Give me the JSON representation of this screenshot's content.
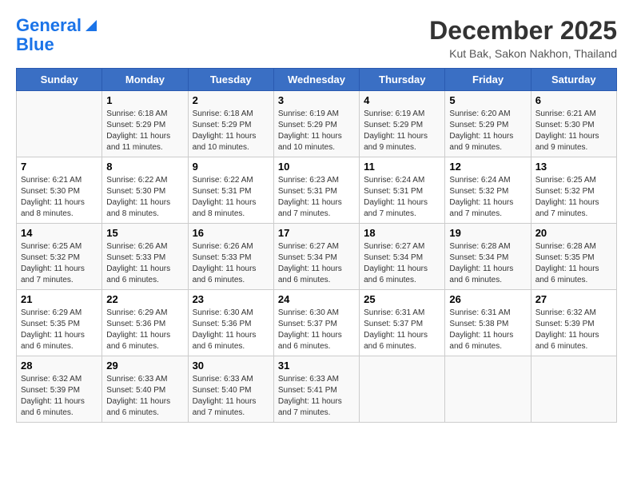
{
  "logo": {
    "line1": "General",
    "line2": "Blue"
  },
  "title": "December 2025",
  "subtitle": "Kut Bak, Sakon Nakhon, Thailand",
  "days_of_week": [
    "Sunday",
    "Monday",
    "Tuesday",
    "Wednesday",
    "Thursday",
    "Friday",
    "Saturday"
  ],
  "weeks": [
    [
      {
        "day": "",
        "info": ""
      },
      {
        "day": "1",
        "info": "Sunrise: 6:18 AM\nSunset: 5:29 PM\nDaylight: 11 hours\nand 11 minutes."
      },
      {
        "day": "2",
        "info": "Sunrise: 6:18 AM\nSunset: 5:29 PM\nDaylight: 11 hours\nand 10 minutes."
      },
      {
        "day": "3",
        "info": "Sunrise: 6:19 AM\nSunset: 5:29 PM\nDaylight: 11 hours\nand 10 minutes."
      },
      {
        "day": "4",
        "info": "Sunrise: 6:19 AM\nSunset: 5:29 PM\nDaylight: 11 hours\nand 9 minutes."
      },
      {
        "day": "5",
        "info": "Sunrise: 6:20 AM\nSunset: 5:29 PM\nDaylight: 11 hours\nand 9 minutes."
      },
      {
        "day": "6",
        "info": "Sunrise: 6:21 AM\nSunset: 5:30 PM\nDaylight: 11 hours\nand 9 minutes."
      }
    ],
    [
      {
        "day": "7",
        "info": "Sunrise: 6:21 AM\nSunset: 5:30 PM\nDaylight: 11 hours\nand 8 minutes."
      },
      {
        "day": "8",
        "info": "Sunrise: 6:22 AM\nSunset: 5:30 PM\nDaylight: 11 hours\nand 8 minutes."
      },
      {
        "day": "9",
        "info": "Sunrise: 6:22 AM\nSunset: 5:31 PM\nDaylight: 11 hours\nand 8 minutes."
      },
      {
        "day": "10",
        "info": "Sunrise: 6:23 AM\nSunset: 5:31 PM\nDaylight: 11 hours\nand 7 minutes."
      },
      {
        "day": "11",
        "info": "Sunrise: 6:24 AM\nSunset: 5:31 PM\nDaylight: 11 hours\nand 7 minutes."
      },
      {
        "day": "12",
        "info": "Sunrise: 6:24 AM\nSunset: 5:32 PM\nDaylight: 11 hours\nand 7 minutes."
      },
      {
        "day": "13",
        "info": "Sunrise: 6:25 AM\nSunset: 5:32 PM\nDaylight: 11 hours\nand 7 minutes."
      }
    ],
    [
      {
        "day": "14",
        "info": "Sunrise: 6:25 AM\nSunset: 5:32 PM\nDaylight: 11 hours\nand 7 minutes."
      },
      {
        "day": "15",
        "info": "Sunrise: 6:26 AM\nSunset: 5:33 PM\nDaylight: 11 hours\nand 6 minutes."
      },
      {
        "day": "16",
        "info": "Sunrise: 6:26 AM\nSunset: 5:33 PM\nDaylight: 11 hours\nand 6 minutes."
      },
      {
        "day": "17",
        "info": "Sunrise: 6:27 AM\nSunset: 5:34 PM\nDaylight: 11 hours\nand 6 minutes."
      },
      {
        "day": "18",
        "info": "Sunrise: 6:27 AM\nSunset: 5:34 PM\nDaylight: 11 hours\nand 6 minutes."
      },
      {
        "day": "19",
        "info": "Sunrise: 6:28 AM\nSunset: 5:34 PM\nDaylight: 11 hours\nand 6 minutes."
      },
      {
        "day": "20",
        "info": "Sunrise: 6:28 AM\nSunset: 5:35 PM\nDaylight: 11 hours\nand 6 minutes."
      }
    ],
    [
      {
        "day": "21",
        "info": "Sunrise: 6:29 AM\nSunset: 5:35 PM\nDaylight: 11 hours\nand 6 minutes."
      },
      {
        "day": "22",
        "info": "Sunrise: 6:29 AM\nSunset: 5:36 PM\nDaylight: 11 hours\nand 6 minutes."
      },
      {
        "day": "23",
        "info": "Sunrise: 6:30 AM\nSunset: 5:36 PM\nDaylight: 11 hours\nand 6 minutes."
      },
      {
        "day": "24",
        "info": "Sunrise: 6:30 AM\nSunset: 5:37 PM\nDaylight: 11 hours\nand 6 minutes."
      },
      {
        "day": "25",
        "info": "Sunrise: 6:31 AM\nSunset: 5:37 PM\nDaylight: 11 hours\nand 6 minutes."
      },
      {
        "day": "26",
        "info": "Sunrise: 6:31 AM\nSunset: 5:38 PM\nDaylight: 11 hours\nand 6 minutes."
      },
      {
        "day": "27",
        "info": "Sunrise: 6:32 AM\nSunset: 5:39 PM\nDaylight: 11 hours\nand 6 minutes."
      }
    ],
    [
      {
        "day": "28",
        "info": "Sunrise: 6:32 AM\nSunset: 5:39 PM\nDaylight: 11 hours\nand 6 minutes."
      },
      {
        "day": "29",
        "info": "Sunrise: 6:33 AM\nSunset: 5:40 PM\nDaylight: 11 hours\nand 6 minutes."
      },
      {
        "day": "30",
        "info": "Sunrise: 6:33 AM\nSunset: 5:40 PM\nDaylight: 11 hours\nand 7 minutes."
      },
      {
        "day": "31",
        "info": "Sunrise: 6:33 AM\nSunset: 5:41 PM\nDaylight: 11 hours\nand 7 minutes."
      },
      {
        "day": "",
        "info": ""
      },
      {
        "day": "",
        "info": ""
      },
      {
        "day": "",
        "info": ""
      }
    ]
  ]
}
